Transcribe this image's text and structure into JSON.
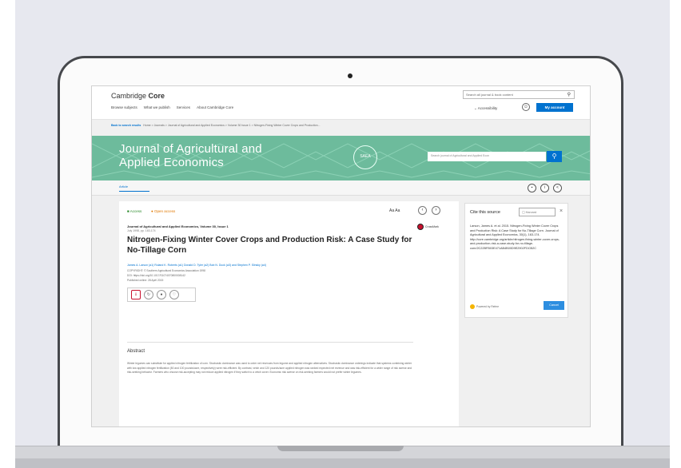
{
  "site": {
    "logo_prefix": "Cambridge",
    "logo_bold": "Core",
    "search_placeholder": "Search all journal & book content",
    "nav": [
      "Browse subjects",
      "What we publish",
      "Services",
      "About Cambridge Core"
    ],
    "accessibility": "Accessibility",
    "my_account": "My account"
  },
  "breadcrumbs": {
    "back": "Back to search results",
    "trail": "Home  >  Journals  >  Journal of Agricultural and Applied Economics  >  Volume 30 Issue 1  >  Nitrogen-Fixing Winter Cover Crops and Production..."
  },
  "journal": {
    "title_line1": "Journal of Agricultural and",
    "title_line2": "Applied Economics",
    "seal": "SAEA",
    "search_placeholder": "Search journal of Agricultural and Applied Econ",
    "tab": "Article"
  },
  "article": {
    "access": "Access",
    "open_access": "Open access",
    "text_size": "Aa  Aa",
    "crossmark": "CrossMark",
    "journal_line": "Journal of Agricultural and Applied Economics, Volume 30, Issue 1",
    "volume_line": "July 1998, pp. 163-174",
    "title": "Nitrogen-Fixing Winter Cover Crops and Production Risk: A Case Study for No-Tillage Corn",
    "authors": "James A. Larson (a1)  Roland K. Roberts (a1)  Donald D. Tyler (a2)  Bob N. Duck (a3) and Stephen P. Slinsky (a4)",
    "copyright": "COPYRIGHT: © Southern Agricultural Economics Association 1998",
    "doi": "DOI: https://doi.org/10.1017/S1074070800008142",
    "published": "Published online: 28 April 2015",
    "abstract_heading": "Abstract",
    "abstract_text": "Winter legumes can substitute for applied nitrogen fertilization of corn. Stochastic dominance was used to order net revenues from legume and applied nitrogen alternatives. Stochastic dominance orderings indicate that systems combining winter with low applied nitrogen fertilization (50 and 100 pounds/acre, respectively) were risk-efficient. By contrast, vetch and 120 pounds/acre applied nitrogen was ranked expected net revenue and was risk-efficient for a wider range of risk averse and risk-seeking behavior. Farmers who choose risk-accepting may not reduce applied nitrogen if they switch to a vetch cover. Economic risk averse on risk-seeking farmers would not prefer winter legumes."
  },
  "cite": {
    "heading": "Cite this source",
    "select": "Harvard",
    "text": "Larson, James A. et al. 2015. Nitrogen-Fixing Winter Cover Crops and Production Risk: A Case Study for No-Tillage Corn. Journal of Agricultural and Applied Economics, 30(1), 163-174. http://core.cambridge.org/article/nitrogen-fixing-winter-cover-crops-and-production-risk-a-case-study-for-no-tillage-corn/2C22BFB03E471AB4B00D9E2902FDCB2C",
    "powered": "Powered by Refme",
    "cancel": "Cancel"
  },
  "colors": {
    "brand_blue": "#0072cf",
    "banner_green": "#6dbb9c",
    "crossmark_red": "#c8102e"
  },
  "icons": [
    "search-icon",
    "user-icon",
    "seal-icon",
    "pdf-icon",
    "share-icon",
    "arrow-left-icon",
    "arrow-right-icon"
  ]
}
